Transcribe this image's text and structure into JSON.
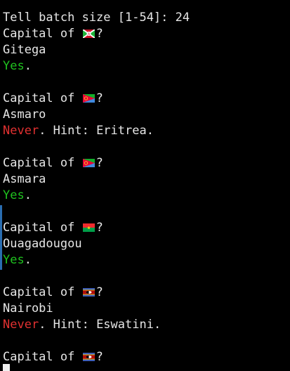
{
  "prompt": {
    "text": "Tell batch size [1-54]: ",
    "answer": "24"
  },
  "question_prefix": "Capital of ",
  "question_suffix": "?",
  "hint_prefix": ". Hint: ",
  "entries": [
    {
      "flag": "burundi-flag",
      "answer": "Gitega",
      "verdict": "Yes",
      "tail": "."
    },
    {
      "flag": "eritrea-flag",
      "answer": "Asmaro",
      "verdict": "Never",
      "tail": ". Hint: Eritrea."
    },
    {
      "flag": "eritrea-flag",
      "answer": "Asmara",
      "verdict": "Yes",
      "tail": "."
    },
    {
      "flag": "burkina-faso-flag",
      "answer": "Ouagadougou",
      "verdict": "Yes",
      "tail": "."
    },
    {
      "flag": "eswatini-flag",
      "answer": "Nairobi",
      "verdict": "Never",
      "tail": ". Hint: Eswatini."
    },
    {
      "flag": "eswatini-flag"
    }
  ],
  "colors": {
    "correct": "#1fc21f",
    "wrong": "#e23131",
    "scroll_marker": "#2a6db0"
  }
}
